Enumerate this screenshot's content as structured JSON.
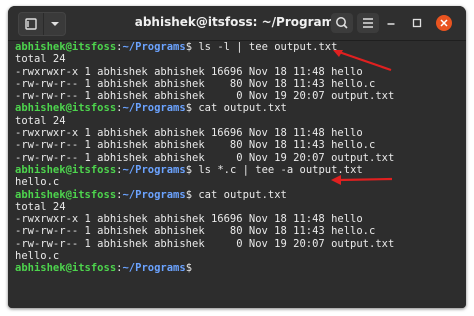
{
  "window": {
    "title": "abhishek@itsfoss: ~/Programs"
  },
  "titlebar": {
    "new_tab_icon": "new-tab-icon",
    "menu_icon": "chevron-down-icon",
    "search_icon": "search-icon",
    "hamburger_icon": "hamburger-menu-icon",
    "minimize_icon": "minimize-icon",
    "maximize_icon": "maximize-icon",
    "close_icon": "close-icon"
  },
  "colors": {
    "user": "#4dd44d",
    "path": "#6ba3ff",
    "text": "#eaeaea",
    "background": "#2d2d2d",
    "close_button": "#e95420",
    "annotation_arrow": "#e02020"
  },
  "prompt": {
    "user": "abhishek@itsfoss",
    "sep": ":",
    "path": "~/Programs",
    "symbol": "$ "
  },
  "lines": [
    {
      "type": "prompt",
      "command": "ls -l | tee output.txt"
    },
    {
      "type": "output",
      "text": "total 24"
    },
    {
      "type": "output",
      "text": "-rwxrwxr-x 1 abhishek abhishek 16696 Nov 18 11:48 hello"
    },
    {
      "type": "output",
      "text": "-rw-rw-r-- 1 abhishek abhishek    80 Nov 18 11:43 hello.c"
    },
    {
      "type": "output",
      "text": "-rw-rw-r-- 1 abhishek abhishek     0 Nov 19 20:07 output.txt"
    },
    {
      "type": "prompt",
      "command": "cat output.txt"
    },
    {
      "type": "output",
      "text": "total 24"
    },
    {
      "type": "output",
      "text": "-rwxrwxr-x 1 abhishek abhishek 16696 Nov 18 11:48 hello"
    },
    {
      "type": "output",
      "text": "-rw-rw-r-- 1 abhishek abhishek    80 Nov 18 11:43 hello.c"
    },
    {
      "type": "output",
      "text": "-rw-rw-r-- 1 abhishek abhishek     0 Nov 19 20:07 output.txt"
    },
    {
      "type": "prompt",
      "command": "ls *.c | tee -a output.txt"
    },
    {
      "type": "output",
      "text": "hello.c"
    },
    {
      "type": "prompt",
      "command": "cat output.txt"
    },
    {
      "type": "output",
      "text": "total 24"
    },
    {
      "type": "output",
      "text": "-rwxrwxr-x 1 abhishek abhishek 16696 Nov 18 11:48 hello"
    },
    {
      "type": "output",
      "text": "-rw-rw-r-- 1 abhishek abhishek    80 Nov 18 11:43 hello.c"
    },
    {
      "type": "output",
      "text": "-rw-rw-r-- 1 abhishek abhishek     0 Nov 19 20:07 output.txt"
    },
    {
      "type": "output",
      "text": "hello.c"
    },
    {
      "type": "prompt",
      "command": ""
    }
  ]
}
